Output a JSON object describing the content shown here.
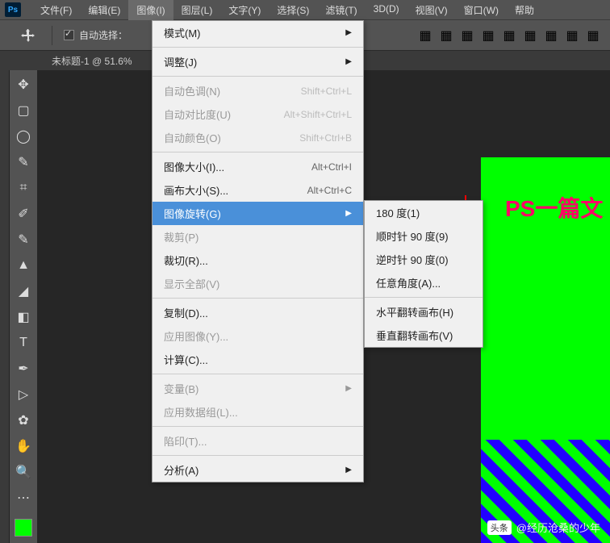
{
  "logo": "Ps",
  "menubar": [
    "文件(F)",
    "编辑(E)",
    "图像(I)",
    "图层(L)",
    "文字(Y)",
    "选择(S)",
    "滤镜(T)",
    "3D(D)",
    "视图(V)",
    "窗口(W)",
    "帮助"
  ],
  "activeMenu": 2,
  "optionsBar": {
    "autoSelect": "自动选择："
  },
  "docTab": "未标题-1 @ 51.6%",
  "canvasText": "PS一篇文",
  "dropdown": {
    "items": [
      {
        "label": "模式(M)",
        "sub": true
      },
      {
        "sep": true
      },
      {
        "label": "调整(J)",
        "sub": true
      },
      {
        "sep": true
      },
      {
        "label": "自动色调(N)",
        "shortcut": "Shift+Ctrl+L",
        "disabled": true
      },
      {
        "label": "自动对比度(U)",
        "shortcut": "Alt+Shift+Ctrl+L",
        "disabled": true
      },
      {
        "label": "自动颜色(O)",
        "shortcut": "Shift+Ctrl+B",
        "disabled": true
      },
      {
        "sep": true
      },
      {
        "label": "图像大小(I)...",
        "shortcut": "Alt+Ctrl+I"
      },
      {
        "label": "画布大小(S)...",
        "shortcut": "Alt+Ctrl+C"
      },
      {
        "label": "图像旋转(G)",
        "sub": true,
        "highlight": true
      },
      {
        "label": "裁剪(P)",
        "disabled": true
      },
      {
        "label": "裁切(R)..."
      },
      {
        "label": "显示全部(V)",
        "disabled": true
      },
      {
        "sep": true
      },
      {
        "label": "复制(D)..."
      },
      {
        "label": "应用图像(Y)...",
        "disabled": true
      },
      {
        "label": "计算(C)..."
      },
      {
        "sep": true
      },
      {
        "label": "变量(B)",
        "sub": true,
        "disabled": true
      },
      {
        "label": "应用数据组(L)...",
        "disabled": true
      },
      {
        "sep": true
      },
      {
        "label": "陷印(T)...",
        "disabled": true
      },
      {
        "sep": true
      },
      {
        "label": "分析(A)",
        "sub": true
      }
    ]
  },
  "submenu": [
    {
      "label": "180 度(1)"
    },
    {
      "label": "顺时针 90 度(9)"
    },
    {
      "label": "逆时针 90 度(0)"
    },
    {
      "label": "任意角度(A)..."
    },
    {
      "sep": true
    },
    {
      "label": "水平翻转画布(H)"
    },
    {
      "label": "垂直翻转画布(V)"
    }
  ],
  "watermark": {
    "logo": "头条",
    "text": "@经历沧桑的少年"
  }
}
